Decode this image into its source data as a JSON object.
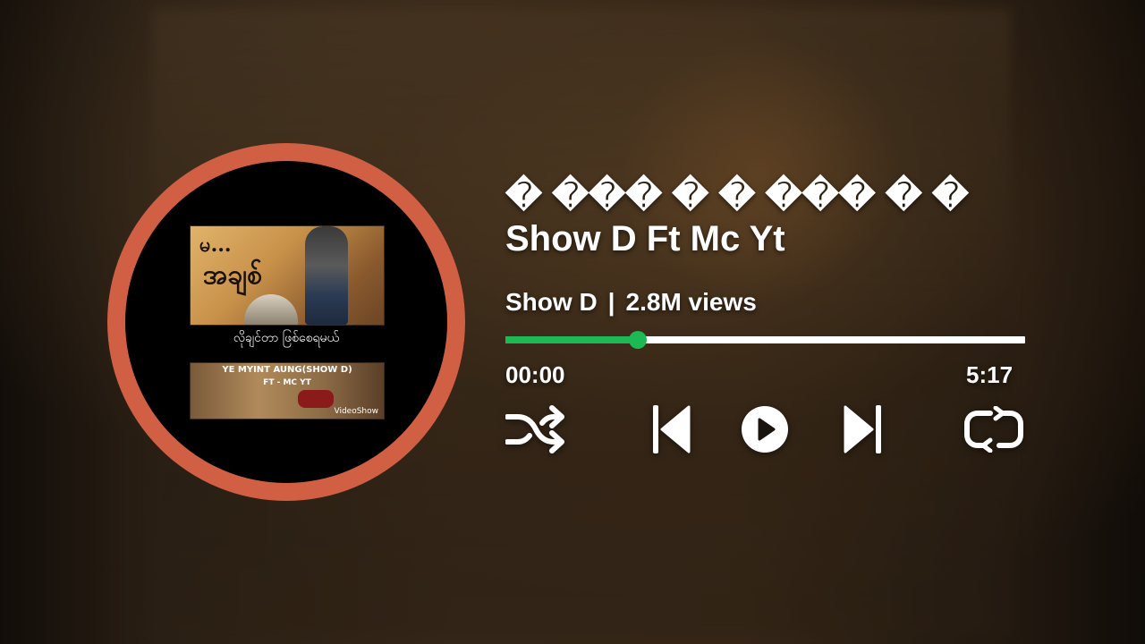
{
  "player": {
    "title": "� ��� � � ��� � � Show D Ft Mc Yt",
    "artist": "Show D",
    "separator": "|",
    "views": "2.8M views",
    "current_time": "00:00",
    "duration": "5:17",
    "progress_fraction": 0.254
  },
  "album_art": {
    "caption": "လိုချင်တာ ဖြစ်စေရမယ်",
    "bottom_line1": "YE MYINT AUNG(SHOW D)",
    "bottom_line2": "FT - MC YT",
    "watermark": "VideoShow",
    "top_glyph": "မ...",
    "top_glyph2": "အချစ်"
  },
  "controls": {
    "shuffle_icon": "shuffle-icon",
    "previous_icon": "skip-previous-icon",
    "play_icon": "play-circle-icon",
    "next_icon": "skip-next-icon",
    "repeat_icon": "repeat-icon"
  },
  "colors": {
    "accent": "#1db954",
    "ring": "#d15f43",
    "text": "#ffffff"
  }
}
